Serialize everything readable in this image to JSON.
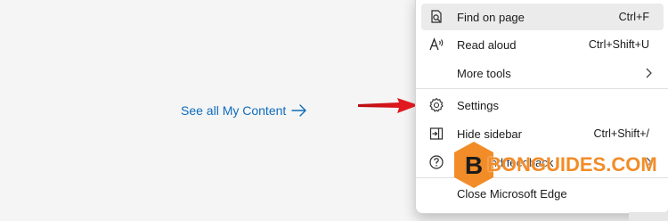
{
  "page": {
    "link_text": "See all My Content"
  },
  "menu": {
    "items": [
      {
        "label": "Find on page",
        "shortcut": "Ctrl+F",
        "icon": "find-on-page-icon"
      },
      {
        "label": "Read aloud",
        "shortcut": "Ctrl+Shift+U",
        "icon": "read-aloud-icon"
      },
      {
        "label": "More tools",
        "shortcut": "",
        "icon": ""
      },
      {
        "label": "Settings",
        "shortcut": "",
        "icon": "gear-icon"
      },
      {
        "label": "Hide sidebar",
        "shortcut": "Ctrl+Shift+/",
        "icon": "hide-sidebar-icon"
      },
      {
        "label": "Help and feedback",
        "shortcut": "",
        "icon": "help-icon"
      },
      {
        "label": "Close Microsoft Edge",
        "shortcut": "",
        "icon": ""
      }
    ]
  },
  "overlay": {
    "brand_text": "BONGUIDES.COM",
    "brand_letter": "B",
    "brand_color": "#f28c28",
    "pointer_color": "#e0161e"
  },
  "colors": {
    "link": "#0f6cbd",
    "menu_bg": "#ffffff",
    "hover_bg": "#ebebeb"
  }
}
